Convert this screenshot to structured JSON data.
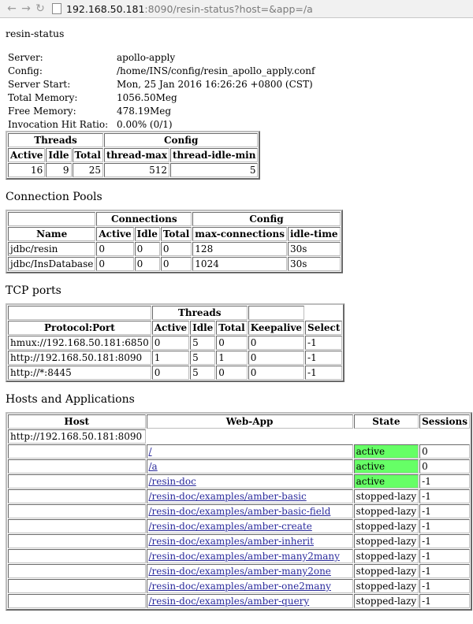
{
  "browser": {
    "url_host": "192.168.50.181",
    "url_rest": ":8090/resin-status?host=&app=/a"
  },
  "page_title": "resin-status",
  "info": [
    {
      "label": "Server:",
      "value": "apollo-apply"
    },
    {
      "label": "Config:",
      "value": "/home/INS/config/resin_apollo_apply.conf"
    },
    {
      "label": "Server Start:",
      "value": "Mon, 25 Jan 2016 16:26:26 +0800 (CST)"
    },
    {
      "label": "Total Memory:",
      "value": "1056.50Meg"
    },
    {
      "label": "Free Memory:",
      "value": "478.19Meg"
    },
    {
      "label": "Invocation Hit Ratio:",
      "value": "0.00% (0/1)"
    }
  ],
  "threads": {
    "group_threads": "Threads",
    "group_config": "Config",
    "headers": [
      "Active",
      "Idle",
      "Total",
      "thread-max",
      "thread-idle-min"
    ],
    "values": [
      "16",
      "9",
      "25",
      "512",
      "5"
    ]
  },
  "connection_pools": {
    "heading": "Connection Pools",
    "group_connections": "Connections",
    "group_config": "Config",
    "headers": [
      "Name",
      "Active",
      "Idle",
      "Total",
      "max-connections",
      "idle-time"
    ],
    "rows": [
      [
        "jdbc/resin",
        "0",
        "0",
        "0",
        "128",
        "30s"
      ],
      [
        "jdbc/InsDatabase",
        "0",
        "0",
        "0",
        "1024",
        "30s"
      ]
    ]
  },
  "tcp_ports": {
    "heading": "TCP ports",
    "group_threads": "Threads",
    "headers": [
      "Protocol:Port",
      "Active",
      "Idle",
      "Total",
      "Keepalive",
      "Select"
    ],
    "rows": [
      [
        "hmux://192.168.50.181:6850",
        "0",
        "5",
        "0",
        "0",
        "-1"
      ],
      [
        "http://192.168.50.181:8090",
        "1",
        "5",
        "1",
        "0",
        "-1"
      ],
      [
        "http://*:8445",
        "0",
        "5",
        "0",
        "0",
        "-1"
      ]
    ]
  },
  "hosts": {
    "heading": "Hosts and Applications",
    "headers": [
      "Host",
      "Web-App",
      "State",
      "Sessions"
    ],
    "host_name": "http://192.168.50.181:8090",
    "active_color": "#66ff66",
    "apps": [
      {
        "path": "/",
        "state": "active",
        "sessions": "0"
      },
      {
        "path": "/a",
        "state": "active",
        "sessions": "0"
      },
      {
        "path": "/resin-doc",
        "state": "active",
        "sessions": "-1"
      },
      {
        "path": "/resin-doc/examples/amber-basic",
        "state": "stopped-lazy",
        "sessions": "-1"
      },
      {
        "path": "/resin-doc/examples/amber-basic-field",
        "state": "stopped-lazy",
        "sessions": "-1"
      },
      {
        "path": "/resin-doc/examples/amber-create",
        "state": "stopped-lazy",
        "sessions": "-1"
      },
      {
        "path": "/resin-doc/examples/amber-inherit",
        "state": "stopped-lazy",
        "sessions": "-1"
      },
      {
        "path": "/resin-doc/examples/amber-many2many",
        "state": "stopped-lazy",
        "sessions": "-1"
      },
      {
        "path": "/resin-doc/examples/amber-many2one",
        "state": "stopped-lazy",
        "sessions": "-1"
      },
      {
        "path": "/resin-doc/examples/amber-one2many",
        "state": "stopped-lazy",
        "sessions": "-1"
      },
      {
        "path": "/resin-doc/examples/amber-query",
        "state": "stopped-lazy",
        "sessions": "-1"
      }
    ]
  }
}
